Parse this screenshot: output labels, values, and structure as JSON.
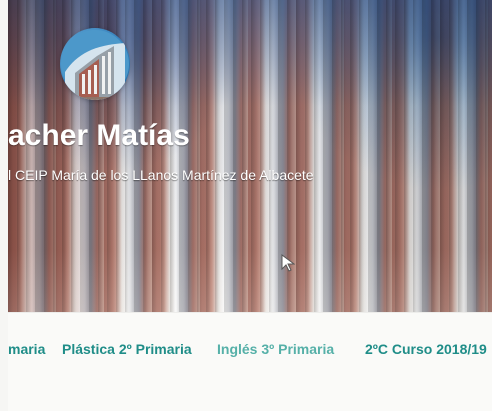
{
  "header": {
    "title": "acher Matías",
    "subtitle": "l CEIP María de los LLanos Martínez de Albacete"
  },
  "logo": {
    "icon": "school-building-logo-icon"
  },
  "cursor": {
    "icon": "mouse-pointer-icon"
  },
  "navigation": {
    "items": [
      {
        "label": "maria"
      },
      {
        "label": "Plástica 2º Primaria"
      },
      {
        "label": "Inglés 3º Primaria"
      },
      {
        "label": "2ºC Curso 2018/19"
      }
    ]
  },
  "colors": {
    "nav_text": "#1f8d88",
    "nav_text_muted": "#55b0a8",
    "hero_blue": "#3b86c0"
  }
}
